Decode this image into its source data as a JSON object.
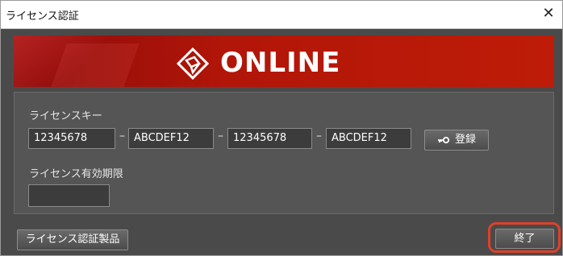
{
  "window": {
    "title": "ライセンス認証",
    "close_glyph": "✕"
  },
  "banner": {
    "text": "ONLINE",
    "logo_icon": "cube-shield-icon"
  },
  "license_key": {
    "label": "ライセンスキー",
    "fields": [
      "12345678",
      "ABCDEF12",
      "12345678",
      "ABCDEF12"
    ],
    "separator": "–",
    "register_label": "登録",
    "register_icon": "key-icon"
  },
  "expiry": {
    "label": "ライセンス有効期限",
    "value": ""
  },
  "footer": {
    "products_button": "ライセンス認証製品",
    "exit_button": "終了"
  },
  "colors": {
    "banner_red": "#b21608",
    "highlight": "#e0402a",
    "bg": "#4a4a4a"
  }
}
